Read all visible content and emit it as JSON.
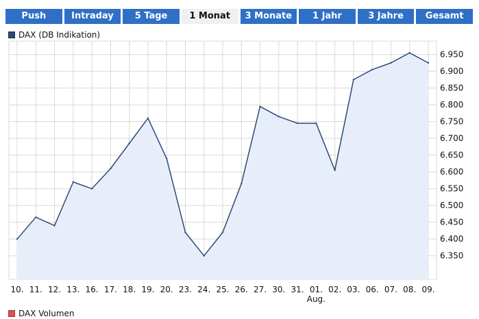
{
  "tabs": [
    {
      "label": "Push",
      "active": false
    },
    {
      "label": "Intraday",
      "active": false
    },
    {
      "label": "5 Tage",
      "active": false
    },
    {
      "label": "1 Monat",
      "active": true
    },
    {
      "label": "3 Monate",
      "active": false
    },
    {
      "label": "1 Jahr",
      "active": false
    },
    {
      "label": "3 Jahre",
      "active": false
    },
    {
      "label": "Gesamt",
      "active": false
    }
  ],
  "legend": {
    "series_label": "DAX (DB Indikation)",
    "color": "#2c4a78"
  },
  "legend_volume": {
    "label": "DAX Volumen"
  },
  "colors": {
    "tab_bg": "#2f6fc6",
    "tab_active_bg": "#eef0f4",
    "line": "#2c4a78",
    "fill": "#e8eef9",
    "grid": "#d8d8d8"
  },
  "chart_data": {
    "type": "area",
    "series": [
      {
        "name": "DAX (DB Indikation)",
        "values": [
          6400,
          6465,
          6440,
          6570,
          6550,
          6610,
          6685,
          6760,
          6640,
          6420,
          6350,
          6420,
          6565,
          6795,
          6765,
          6745,
          6745,
          6605,
          6875,
          6905,
          6925,
          6955,
          6925
        ]
      }
    ],
    "categories": [
      "10.",
      "11.",
      "12.",
      "13.",
      "16.",
      "17.",
      "18.",
      "19.",
      "20.",
      "23.",
      "24.",
      "25.",
      "26.",
      "27.",
      "30.",
      "31.",
      "01.",
      "02.",
      "03.",
      "06.",
      "07.",
      "08.",
      "09."
    ],
    "month_label": {
      "text": "Aug.",
      "category_index": 16
    },
    "y_ticks": [
      6350,
      6400,
      6450,
      6500,
      6550,
      6600,
      6650,
      6700,
      6750,
      6800,
      6850,
      6900,
      6950
    ],
    "y_tick_labels": [
      "6.350",
      "6.400",
      "6.450",
      "6.500",
      "6.550",
      "6.600",
      "6.650",
      "6.700",
      "6.750",
      "6.800",
      "6.850",
      "6.900",
      "6.950"
    ],
    "ylim": [
      6280,
      6990
    ],
    "grid": true,
    "legend_position": "top-left",
    "title": "",
    "xlabel": "",
    "ylabel": ""
  }
}
